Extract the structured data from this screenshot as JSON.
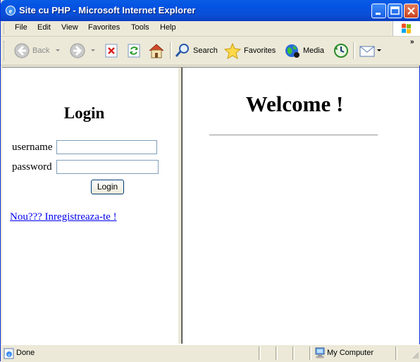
{
  "window": {
    "title": "Site cu PHP - Microsoft Internet Explorer"
  },
  "menubar": {
    "items": [
      "File",
      "Edit",
      "View",
      "Favorites",
      "Tools",
      "Help"
    ]
  },
  "toolbar": {
    "back_label": "Back",
    "search_label": "Search",
    "favorites_label": "Favorites",
    "media_label": "Media"
  },
  "left_frame": {
    "title": "Login",
    "username_label": "username",
    "password_label": "password",
    "username_value": "",
    "password_value": "",
    "login_button": "Login",
    "register_link": "Nou??? Inregistreaza-te !"
  },
  "right_frame": {
    "heading": "Welcome !"
  },
  "statusbar": {
    "status": "Done",
    "zone": "My Computer"
  },
  "colors": {
    "titlebar": "#0a5ce4",
    "link": "#0000ee",
    "chrome": "#ece9d8"
  }
}
